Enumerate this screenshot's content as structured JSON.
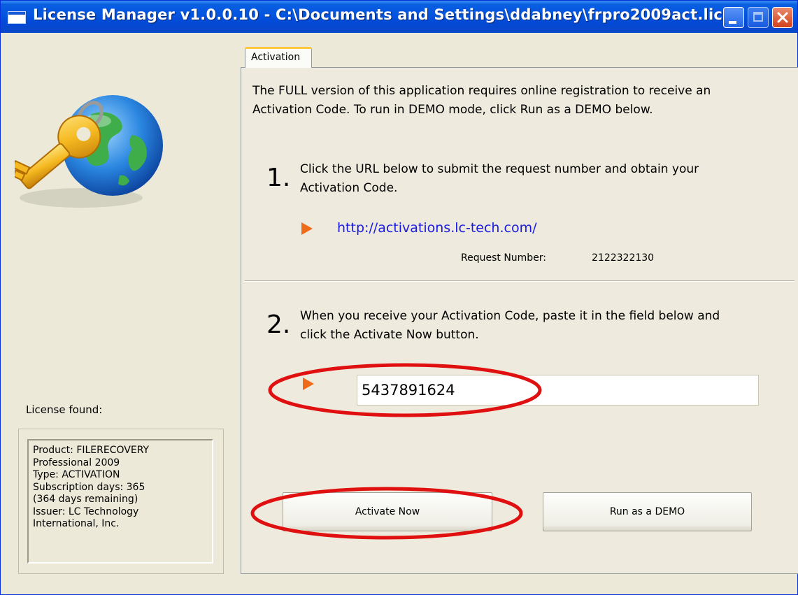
{
  "window": {
    "title": "License Manager v1.0.0.10 - C:\\Documents and Settings\\ddabney\\frpro2009act.lic"
  },
  "sidebar": {
    "license_label": "License found:",
    "license_lines": [
      "Product: FILERECOVERY",
      "Professional 2009",
      "Type: ACTIVATION",
      "Subscription days: 365",
      "(364 days remaining)",
      "Issuer: LC Technology",
      "International, Inc."
    ]
  },
  "tab": {
    "label": "Activation"
  },
  "main": {
    "intro_line1": "The FULL version of this application requires online registration to receive an",
    "intro_line2": "Activation Code. To run in DEMO mode, click Run as a DEMO below.",
    "step1": {
      "number": "1.",
      "line1": "Click the URL below to submit the request number and obtain your",
      "line2": "Activation Code.",
      "url": "http://activations.lc-tech.com/",
      "request_label": "Request Number:",
      "request_value": "2122322130"
    },
    "step2": {
      "number": "2.",
      "line1": "When you receive your Activation Code, paste it in the field below and",
      "line2": "click the Activate Now button.",
      "code_value": "5437891624"
    },
    "buttons": {
      "activate": "Activate Now",
      "demo": "Run as a DEMO"
    }
  },
  "colors": {
    "titlebar": "#0454e0",
    "link": "#1a1ae0",
    "arrow": "#ee6b1a",
    "annotation": "#e01010"
  },
  "icons": {
    "logo": "key-globe-icon",
    "arrow": "play-arrow-icon"
  }
}
